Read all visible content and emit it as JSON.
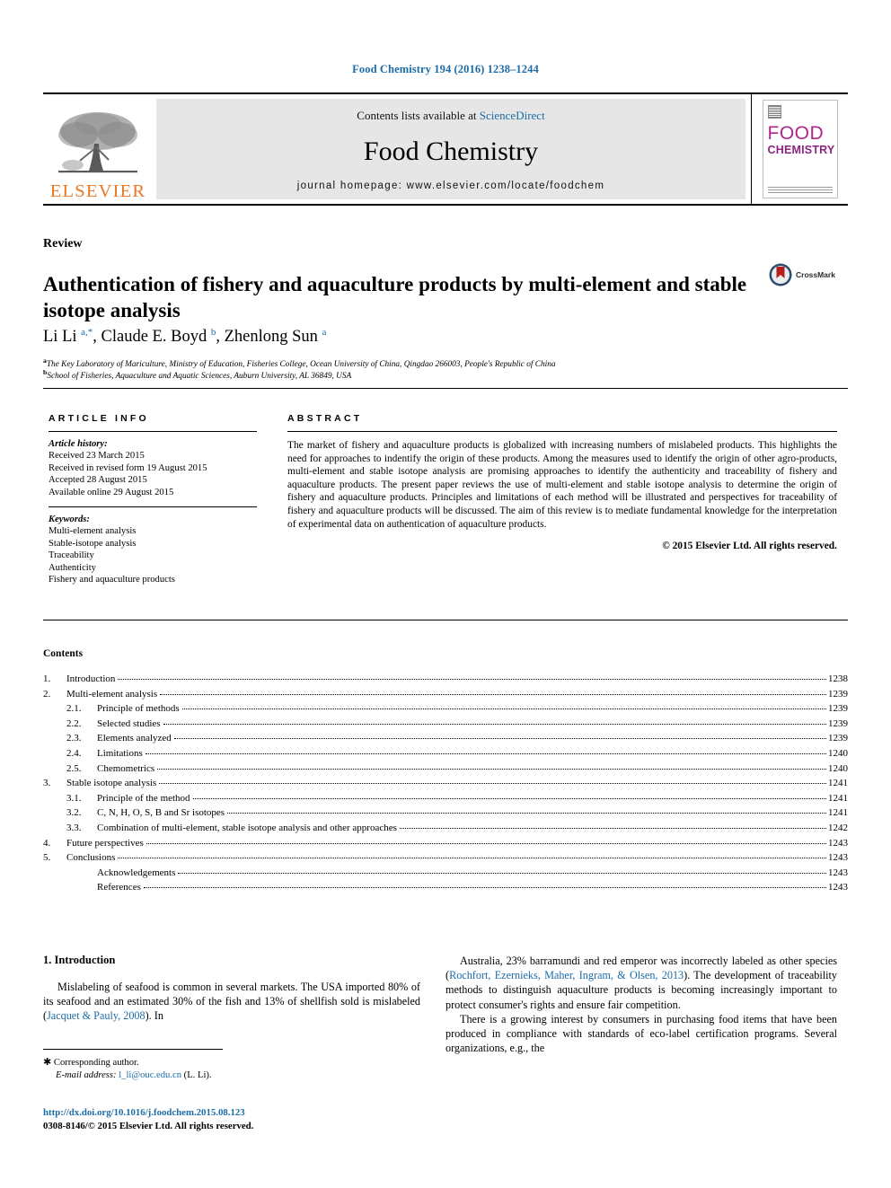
{
  "running_head": "Food Chemistry 194 (2016) 1238–1244",
  "masthead": {
    "contents_prefix": "Contents lists available at ",
    "sciencedirect": "ScienceDirect",
    "journal_name": "Food Chemistry",
    "homepage": "journal homepage: www.elsevier.com/locate/foodchem",
    "publisher_logo_text": "ELSEVIER",
    "cover": {
      "line1": "FOOD",
      "line2": "CHEMISTRY"
    }
  },
  "article": {
    "type": "Review",
    "title": "Authentication of fishery and aquaculture products by multi-element and stable isotope analysis",
    "crossmark_label": "CrossMark",
    "authors_html": "Li Li <sup>a,*</sup>, Claude E. Boyd <sup>b</sup>, Zhenlong Sun <sup>a</sup>",
    "affiliation_a": "The Key Laboratory of Mariculture, Ministry of Education, Fisheries College, Ocean University of China, Qingdao 266003, People's Republic of China",
    "affiliation_b": "School of Fisheries, Aquaculture and Aquatic Sciences, Auburn University, AL 36849, USA"
  },
  "info": {
    "heading": "ARTICLE INFO",
    "history_label": "Article history:",
    "history": [
      "Received 23 March 2015",
      "Received in revised form 19 August 2015",
      "Accepted 28 August 2015",
      "Available online 29 August 2015"
    ],
    "keywords_label": "Keywords:",
    "keywords": [
      "Multi-element analysis",
      "Stable-isotope analysis",
      "Traceability",
      "Authenticity",
      "Fishery and aquaculture products"
    ]
  },
  "abstract": {
    "heading": "ABSTRACT",
    "text": "The market of fishery and aquaculture products is globalized with increasing numbers of mislabeled products. This highlights the need for approaches to indentify the origin of these products. Among the measures used to identify the origin of other agro-products, multi-element and stable isotope analysis are promising approaches to identify the authenticity and traceability of fishery and aquaculture products. The present paper reviews the use of multi-element and stable isotope analysis to determine the origin of fishery and aquaculture products. Principles and limitations of each method will be illustrated and perspectives for traceability of fishery and aquaculture products will be discussed. The aim of this review is to mediate fundamental knowledge for the interpretation of experimental data on authentication of aquaculture products.",
    "copyright": "© 2015 Elsevier Ltd. All rights reserved."
  },
  "contents": {
    "title": "Contents",
    "entries": [
      {
        "num": "1.",
        "sub": "",
        "label": "Introduction",
        "page": "1238",
        "level": 1
      },
      {
        "num": "2.",
        "sub": "",
        "label": "Multi-element analysis",
        "page": "1239",
        "level": 1
      },
      {
        "num": "",
        "sub": "2.1.",
        "label": "Principle of methods",
        "page": "1239",
        "level": 2
      },
      {
        "num": "",
        "sub": "2.2.",
        "label": "Selected studies",
        "page": "1239",
        "level": 2
      },
      {
        "num": "",
        "sub": "2.3.",
        "label": "Elements analyzed",
        "page": "1239",
        "level": 2
      },
      {
        "num": "",
        "sub": "2.4.",
        "label": "Limitations",
        "page": "1240",
        "level": 2
      },
      {
        "num": "",
        "sub": "2.5.",
        "label": "Chemometrics",
        "page": "1240",
        "level": 2
      },
      {
        "num": "3.",
        "sub": "",
        "label": "Stable isotope analysis",
        "page": "1241",
        "level": 1
      },
      {
        "num": "",
        "sub": "3.1.",
        "label": "Principle of the method",
        "page": "1241",
        "level": 2
      },
      {
        "num": "",
        "sub": "3.2.",
        "label": "C, N, H, O, S, B and Sr isotopes",
        "page": "1241",
        "level": 2
      },
      {
        "num": "",
        "sub": "3.3.",
        "label": "Combination of multi-element, stable isotope analysis and other approaches",
        "page": "1242",
        "level": 2
      },
      {
        "num": "4.",
        "sub": "",
        "label": "Future perspectives",
        "page": "1243",
        "level": 1
      },
      {
        "num": "5.",
        "sub": "",
        "label": "Conclusions",
        "page": "1243",
        "level": 1
      },
      {
        "num": "",
        "sub": "",
        "label": "Acknowledgements",
        "page": "1243",
        "level": 3
      },
      {
        "num": "",
        "sub": "",
        "label": "References",
        "page": "1243",
        "level": 3
      }
    ]
  },
  "body": {
    "section_heading": "1. Introduction",
    "left_paragraph_html": "Mislabeling of seafood is common in several markets. The USA imported 80% of its seafood and an estimated 30% of the fish and 13% of shellfish sold is mislabeled (<span class=\"ref\">Jacquet &amp; Pauly, 2008</span>). In",
    "right_paragraph_1_html": "Australia, 23% barramundi and red emperor was incorrectly labeled as other species (<span class=\"ref\">Rochfort, Ezernieks, Maher, Ingram, &amp; Olsen, 2013</span>). The development of traceability methods to distinguish aquaculture products is becoming increasingly important to protect consumer's rights and ensure fair competition.",
    "right_paragraph_2_html": "There is a growing interest by consumers in purchasing food items that have been produced in compliance with standards of eco-label certification programs. Several organizations, e.g., the"
  },
  "footnote": {
    "corresponding": "Corresponding author.",
    "email_label": "E-mail address:",
    "email": "l_li@ouc.edu.cn",
    "email_owner": "(L. Li).",
    "doi": "http://dx.doi.org/10.1016/j.foodchem.2015.08.123",
    "issn_line": "0308-8146/© 2015 Elsevier Ltd. All rights reserved."
  },
  "colors": {
    "link_blue": "#1b6ca8",
    "elsevier_orange": "#E87722",
    "cover_magenta": "#b0268c",
    "crossmark_red": "#b5201f"
  }
}
